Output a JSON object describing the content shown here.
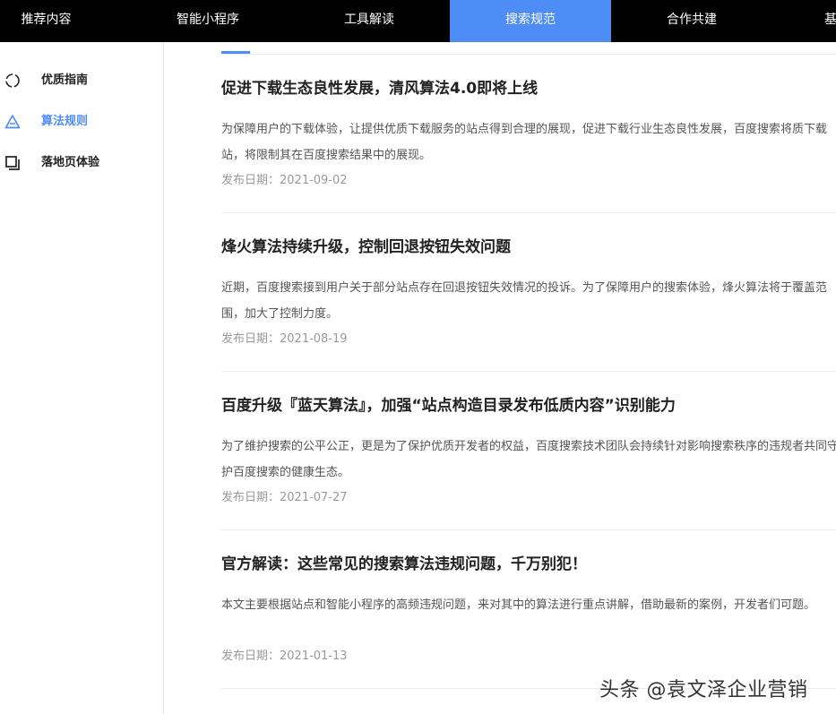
{
  "topnav": {
    "tabs": [
      {
        "label": "推荐内容"
      },
      {
        "label": "智能小程序"
      },
      {
        "label": "工具解读"
      },
      {
        "label": "搜索规范",
        "active": true
      },
      {
        "label": "合作共建"
      },
      {
        "label": "基"
      }
    ],
    "active_color": "#4e8cf6"
  },
  "sidebar": {
    "items": [
      {
        "label": "优质指南",
        "icon": "circle-loading-icon"
      },
      {
        "label": "算法规则",
        "icon": "triangle-icon",
        "active": true
      },
      {
        "label": "落地页体验",
        "icon": "copy-icon"
      }
    ]
  },
  "articles": [
    {
      "title": "促进下载生态良性发展，清风算法4.0即将上线",
      "summary": "为保障用户的下载体验，让提供优质下载服务的站点得到合理的展现，促进下载行业生态良性发展，百度搜索将质下载站，将限制其在百度搜索结果中的展现。",
      "date": "发布日期：2021-09-02"
    },
    {
      "title": "烽火算法持续升级，控制回退按钮失效问题",
      "summary": "近期，百度搜索接到用户关于部分站点存在回退按钮失效情况的投诉。为了保障用户的搜索体验，烽火算法将于覆盖范围，加大了控制力度。",
      "date": "发布日期：2021-08-19"
    },
    {
      "title": "百度升级『蓝天算法』，加强“站点构造目录发布低质内容”识别能力",
      "summary": "为了维护搜索的公平公正，更是为了保护优质开发者的权益，百度搜索技术团队会持续针对影响搜索秩序的违规者共同守护百度搜索的健康生态。",
      "date": "发布日期：2021-07-27"
    },
    {
      "title": "官方解读：这些常见的搜索算法违规问题，千万别犯！",
      "summary": "本文主要根据站点和智能小程序的高频违规问题，来对其中的算法进行重点讲解，借助最新的案例，开发者们可题。",
      "date": "发布日期：2021-01-13"
    }
  ],
  "watermark": "头条 @袁文泽企业营销"
}
